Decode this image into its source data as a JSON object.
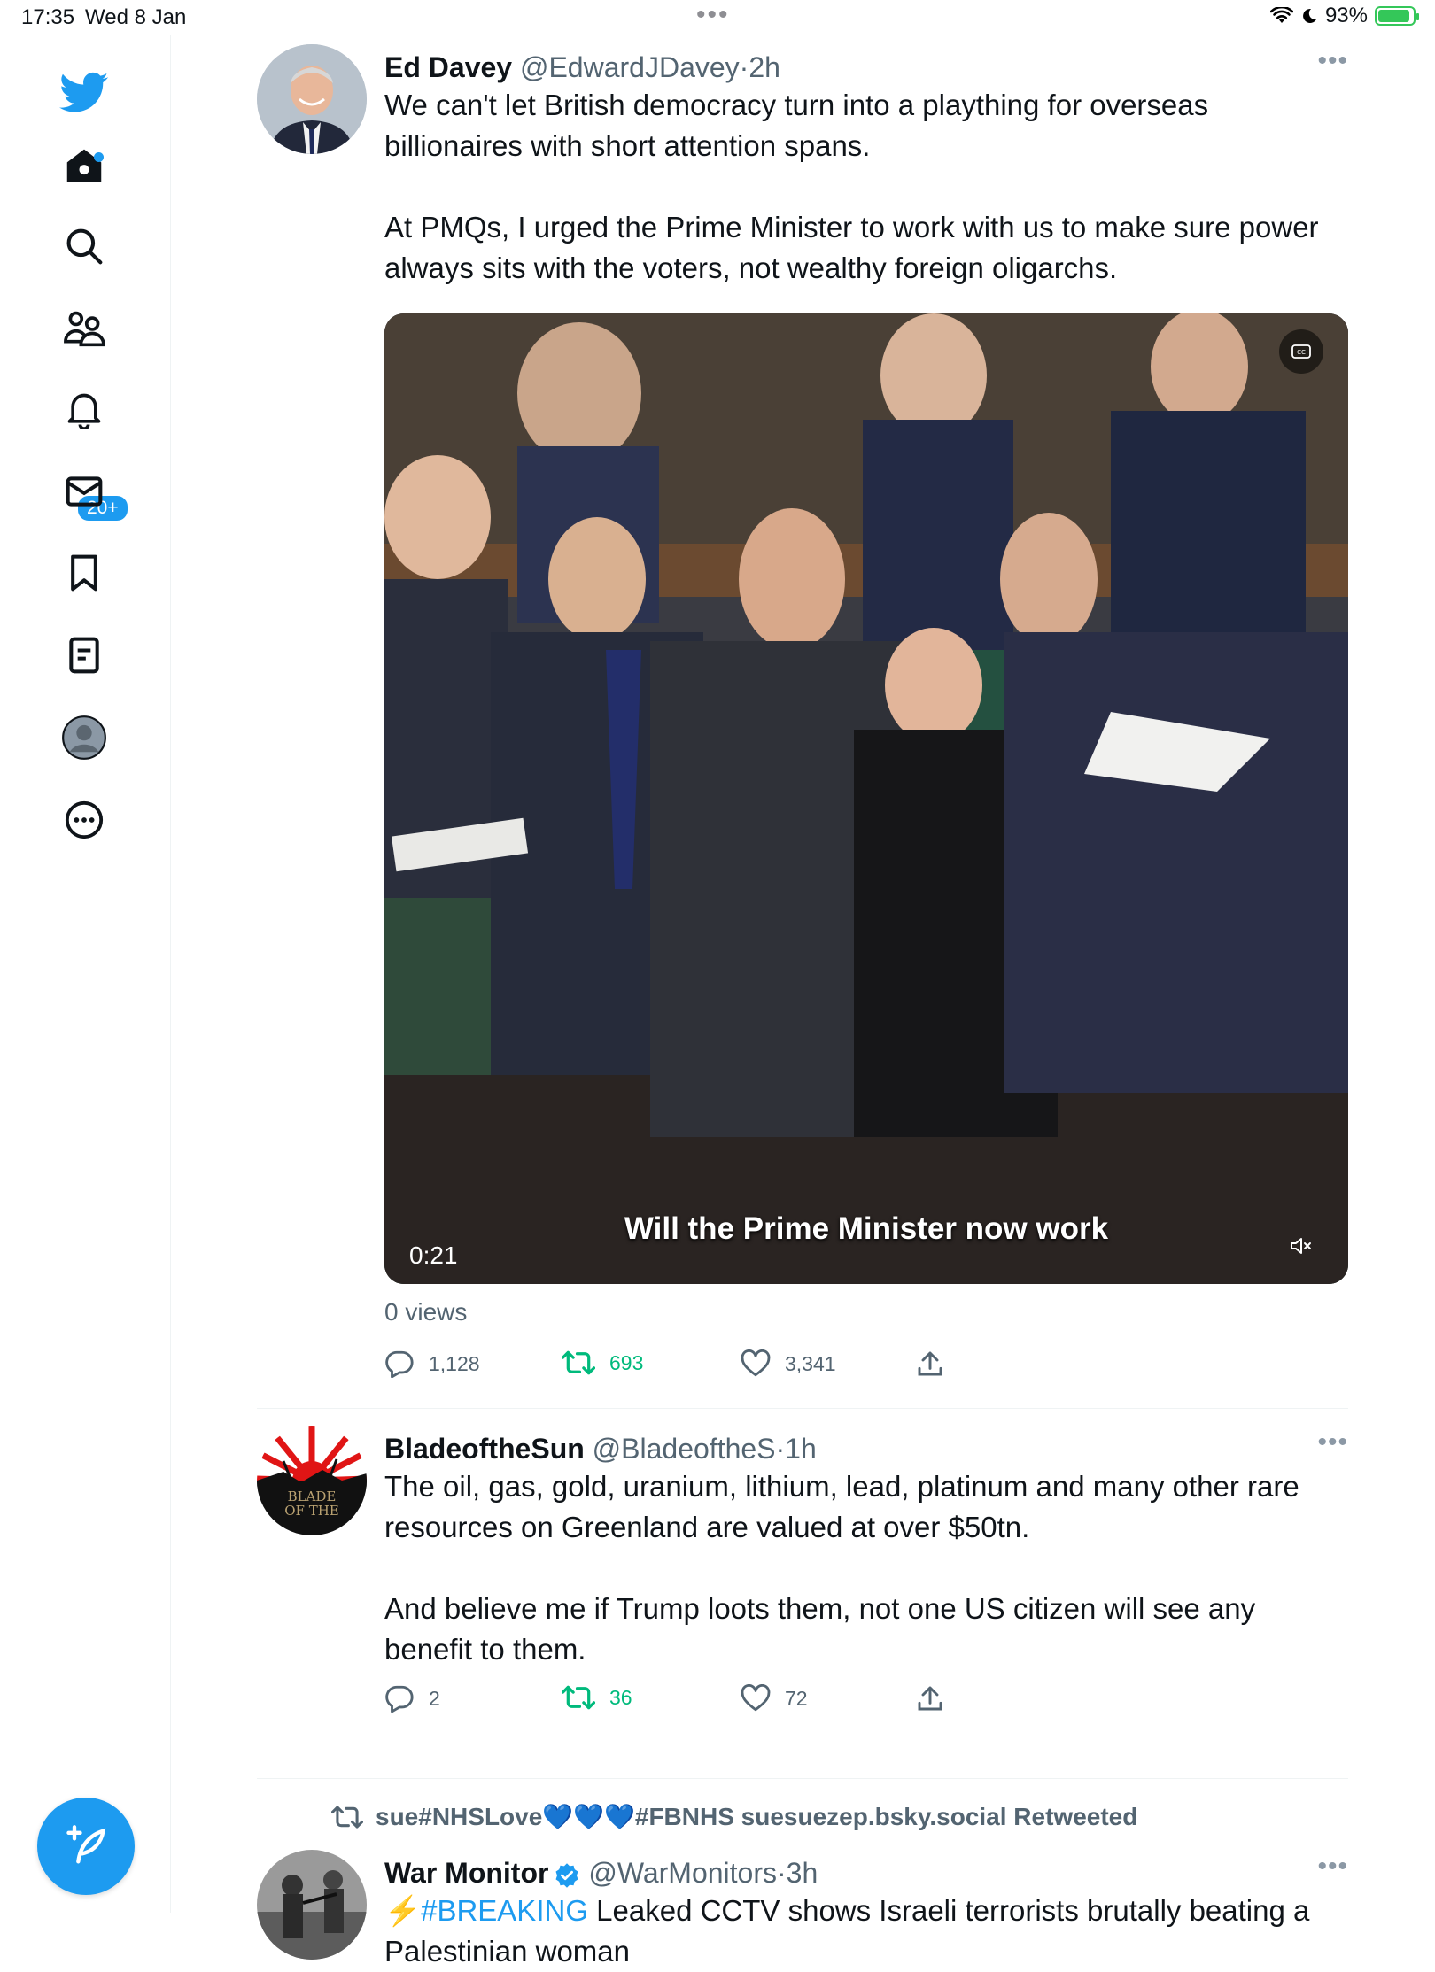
{
  "status_bar": {
    "time": "17:35",
    "date": "Wed 8 Jan",
    "battery": "93%",
    "battery_level": 0.93
  },
  "sidebar": {
    "items": [
      {
        "name": "twitter-logo",
        "label": "Twitter"
      },
      {
        "name": "home",
        "label": "Home"
      },
      {
        "name": "explore",
        "label": "Explore"
      },
      {
        "name": "communities",
        "label": "Communities"
      },
      {
        "name": "notifications",
        "label": "Notifications"
      },
      {
        "name": "messages",
        "label": "Messages"
      },
      {
        "name": "bookmarks",
        "label": "Bookmarks"
      },
      {
        "name": "lists",
        "label": "Lists"
      },
      {
        "name": "profile",
        "label": "Profile"
      },
      {
        "name": "more",
        "label": "More"
      }
    ],
    "notification_badge": "20+"
  },
  "tweets": [
    {
      "name": "Ed Davey",
      "handle": "@EdwardJDavey",
      "separator": "·",
      "age": "2h",
      "text": "We can't let British democracy turn into a plaything for overseas billionaires with short attention spans.\n\nAt PMQs, I urged the Prime Minister to work with us to make sure power always sits with the voters, not wealthy foreign oligarchs.",
      "video": {
        "caption": "Will the Prime Minister now work",
        "duration": "0:21"
      },
      "views": "0 views",
      "replies": "1,128",
      "retweets": "693",
      "likes": "3,341"
    },
    {
      "name": "BladeoftheSun",
      "handle": "@BladeoftheS",
      "separator": "·",
      "age": "1h",
      "avatar_text_top": "BLADE",
      "avatar_text_bottom": "OF THE",
      "text": "The oil, gas, gold, uranium, lithium, lead, platinum and many other rare resources on Greenland are valued at over $50tn.\n\nAnd believe me if Trump loots them, not one US citizen will see any benefit to them.",
      "replies": "2",
      "retweets": "36",
      "likes": "72"
    },
    {
      "retweeted_by": "sue#NHSLove💙💙💙#FBNHS suesuezep.bsky.social Retweeted",
      "name": "War Monitor",
      "handle": "@WarMonitors",
      "separator": "·",
      "age": "3h",
      "text_emoji": "⚡",
      "text_hashtag": "#BREAKING",
      "text": " Leaked CCTV shows Israeli terrorists brutally beating a",
      "text_line2": "Palestinian woman"
    }
  ],
  "colors": {
    "accent": "#1d9bf0",
    "retweet": "#00ba7c",
    "secondary_text": "#536471"
  }
}
